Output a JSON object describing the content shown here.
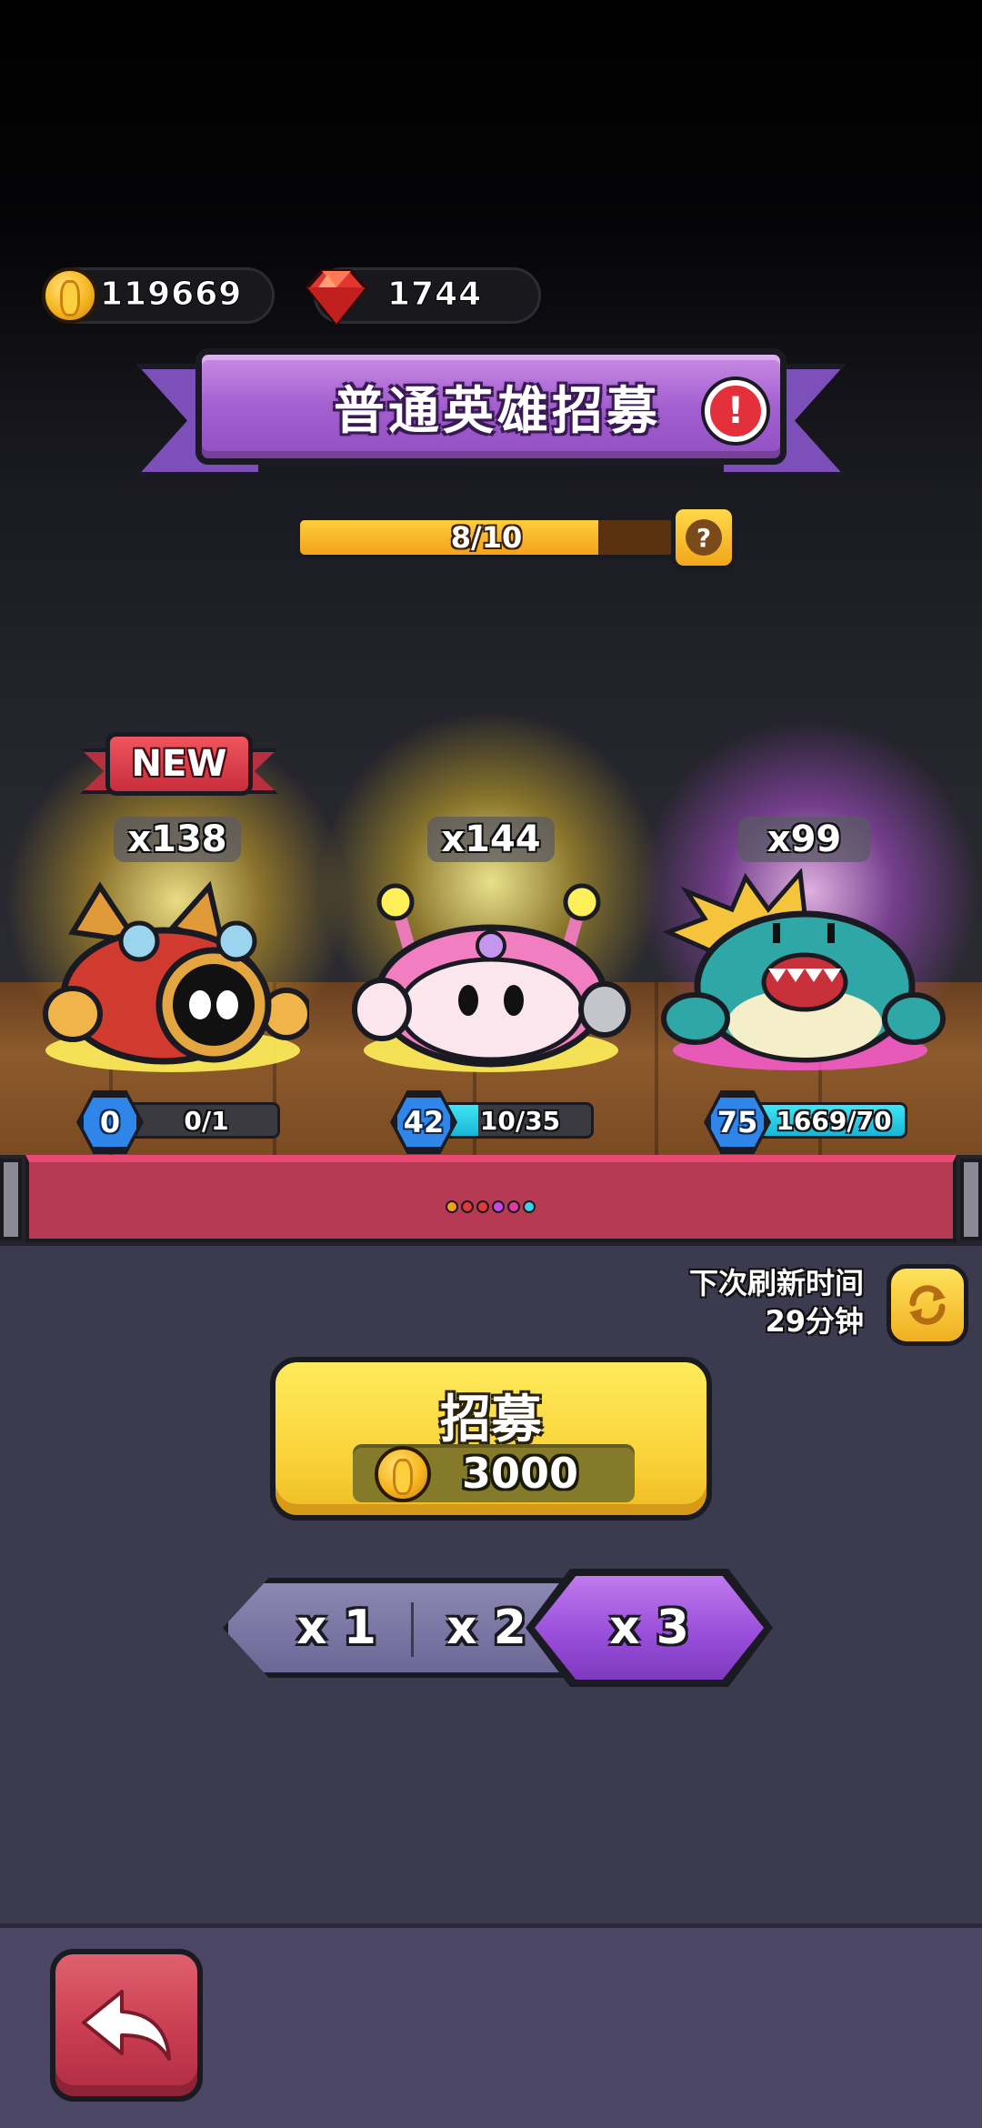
{
  "currency": {
    "coins": "119669",
    "gems": "1744"
  },
  "banner": {
    "title": "普通英雄招募"
  },
  "progress": {
    "text": "8/10",
    "fraction": 0.8
  },
  "heroes": [
    {
      "count": "x138",
      "level": "0",
      "progress_text": "0/1",
      "progress_fraction": 0.0,
      "is_new": true,
      "new_label": "NEW"
    },
    {
      "count": "x144",
      "level": "42",
      "progress_text": "10/35",
      "progress_fraction": 0.29,
      "is_new": false
    },
    {
      "count": "x99",
      "level": "75",
      "progress_text": "1669/70",
      "progress_fraction": 1.0,
      "is_new": false
    }
  ],
  "refresh": {
    "label": "下次刷新时间",
    "time": "29分钟"
  },
  "recruit": {
    "label": "招募",
    "cost": "3000"
  },
  "multipliers": {
    "options": [
      "x 1",
      "x 2",
      "x 3"
    ],
    "selected": "x 3"
  },
  "colors": {
    "banner_purple": "#a45fd0",
    "recruit_yellow": "#f9d43a",
    "level_blue": "#2f86e8",
    "progress_cyan": "#3fe6f4",
    "back_red": "#c63a4e"
  },
  "icons": {
    "coin": "gold-coin-icon",
    "gem": "red-gem-icon",
    "alert": "exclamation-icon",
    "help": "question-icon",
    "refresh": "refresh-icon",
    "back": "back-arrow-icon"
  }
}
